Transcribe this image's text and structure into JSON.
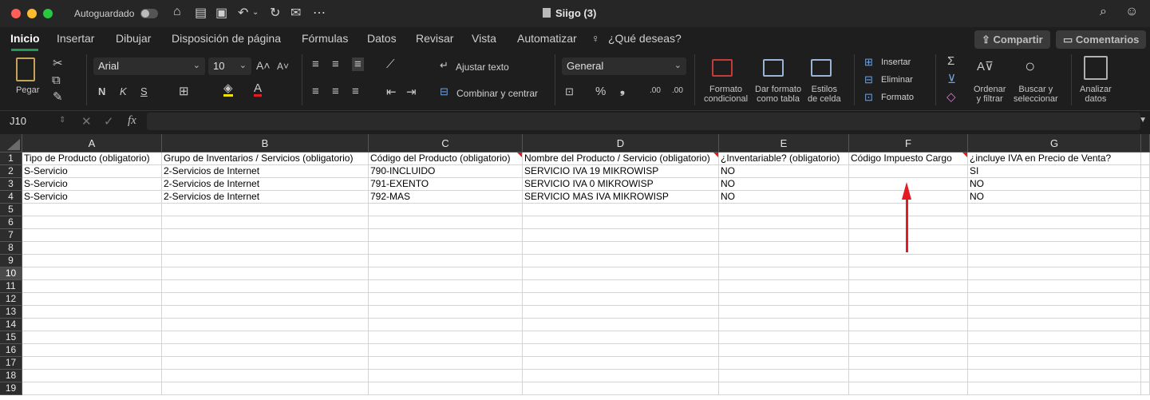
{
  "titlebar": {
    "autosave_label": "Autoguardado",
    "window_title": "Siigo (3)"
  },
  "tabs": [
    "Inicio",
    "Insertar",
    "Dibujar",
    "Disposición de página",
    "Fórmulas",
    "Datos",
    "Revisar",
    "Vista",
    "Automatizar"
  ],
  "tell_me": "¿Qué deseas?",
  "actions": {
    "share": "Compartir",
    "comments": "Comentarios"
  },
  "ribbon": {
    "paste": "Pegar",
    "font_name": "Arial",
    "font_size": "10",
    "bold": "N",
    "italic": "K",
    "underline": "S",
    "wrap_text": "Ajustar texto",
    "merge_center": "Combinar y centrar",
    "number_format": "General",
    "cond_format": [
      "Formato",
      "condicional"
    ],
    "format_table": [
      "Dar formato",
      "como tabla"
    ],
    "cell_styles": [
      "Estilos",
      "de celda"
    ],
    "insert": "Insertar",
    "delete": "Eliminar",
    "format": "Formato",
    "sort_filter": [
      "Ordenar",
      "y filtrar"
    ],
    "find_select": [
      "Buscar y",
      "seleccionar"
    ],
    "analyze": [
      "Analizar",
      "datos"
    ]
  },
  "formula_bar": {
    "cell_ref": "J10",
    "fx": "fx",
    "formula": ""
  },
  "sheet": {
    "columns": [
      "A",
      "B",
      "C",
      "D",
      "E",
      "F",
      "G"
    ],
    "rows": [
      [
        "Tipo de Producto (obligatorio)",
        "Grupo de Inventarios / Servicios (obligatorio)",
        "Código del Producto (obligatorio)",
        "Nombre del Producto / Servicio (obligatorio)",
        "¿Inventariable? (obligatorio)",
        "Código Impuesto Cargo",
        "¿incluye IVA en Precio de Venta?"
      ],
      [
        "S-Servicio",
        "2-Servicios de Internet",
        "790-INCLUIDO",
        "SERVICIO IVA 19 MIKROWISP",
        "NO",
        "",
        "SI"
      ],
      [
        "S-Servicio",
        "2-Servicios de Internet",
        "791-EXENTO",
        "SERVICIO IVA 0 MIKROWISP",
        "NO",
        "",
        "NO"
      ],
      [
        "S-Servicio",
        "2-Servicios de Internet",
        "792-MAS",
        "SERVICIO MAS IVA MIKROWISP",
        "NO",
        "",
        "NO"
      ]
    ],
    "row_numbers": [
      "1",
      "2",
      "3",
      "4",
      "5",
      "6",
      "7",
      "8",
      "9",
      "10",
      "11",
      "12",
      "13",
      "14",
      "15",
      "16",
      "17",
      "18",
      "19"
    ],
    "selected_row": "10"
  },
  "colors": {
    "accent": "#1f9c55",
    "annotation": "#e31b23"
  }
}
